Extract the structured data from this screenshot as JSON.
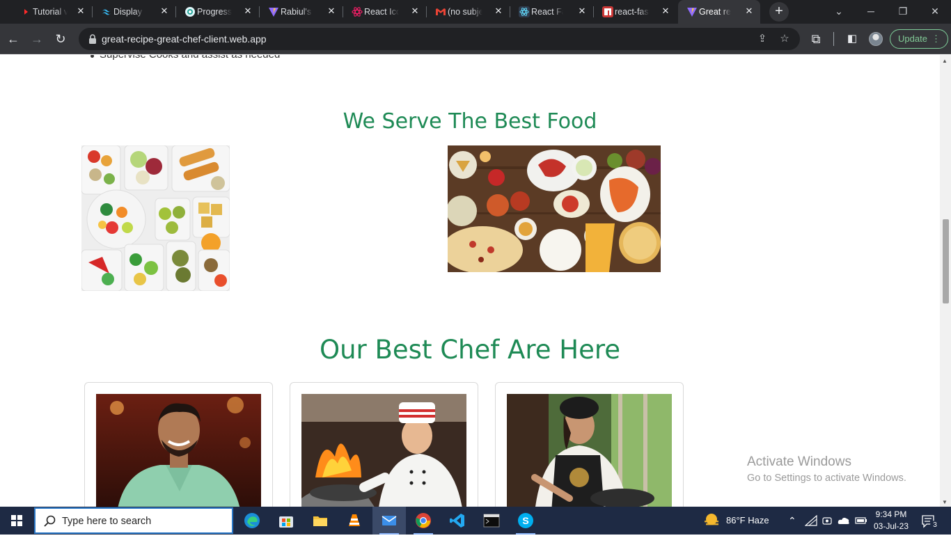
{
  "browser": {
    "tabs": [
      {
        "title": "Tutorial videos",
        "color": "#ff2a2a",
        "icon": "youtube-icon"
      },
      {
        "title": "Display - Tailwind CSS",
        "color": "#38bdf8",
        "icon": "tailwind-icon"
      },
      {
        "title": "Progress",
        "color": "#4dd0e1",
        "icon": "progress-icon"
      },
      {
        "title": "Rabiul's Portfolio",
        "color": "#bd34fe",
        "icon": "vite-icon"
      },
      {
        "title": "React Icons",
        "color": "#e91e63",
        "icon": "react-icons-icon"
      },
      {
        "title": "(no subject)",
        "color": "#ea4335",
        "icon": "gmail-icon"
      },
      {
        "title": "React Fast Marquee",
        "color": "#61dafb",
        "icon": "react-icon"
      },
      {
        "title": "react-fast-marquee",
        "color": "#cb3837",
        "icon": "npm-icon"
      },
      {
        "title": "Great recipe",
        "color": "#bd34fe",
        "icon": "vite-icon",
        "active": true
      }
    ],
    "url": "great-recipe-great-chef-client.web.app",
    "update_label": "Update"
  },
  "page": {
    "bullet_text": "Supervise Cooks and assist as needed",
    "food_section_title": "We Serve The Best Food",
    "chef_section_title": "Our Best Chef Are Here"
  },
  "watermark": {
    "line1": "Activate Windows",
    "line2": "Go to Settings to activate Windows."
  },
  "taskbar": {
    "search_placeholder": "Type here to search",
    "weather": "86°F  Haze",
    "time": "9:34 PM",
    "date": "03-Jul-23",
    "notifications": "3"
  }
}
